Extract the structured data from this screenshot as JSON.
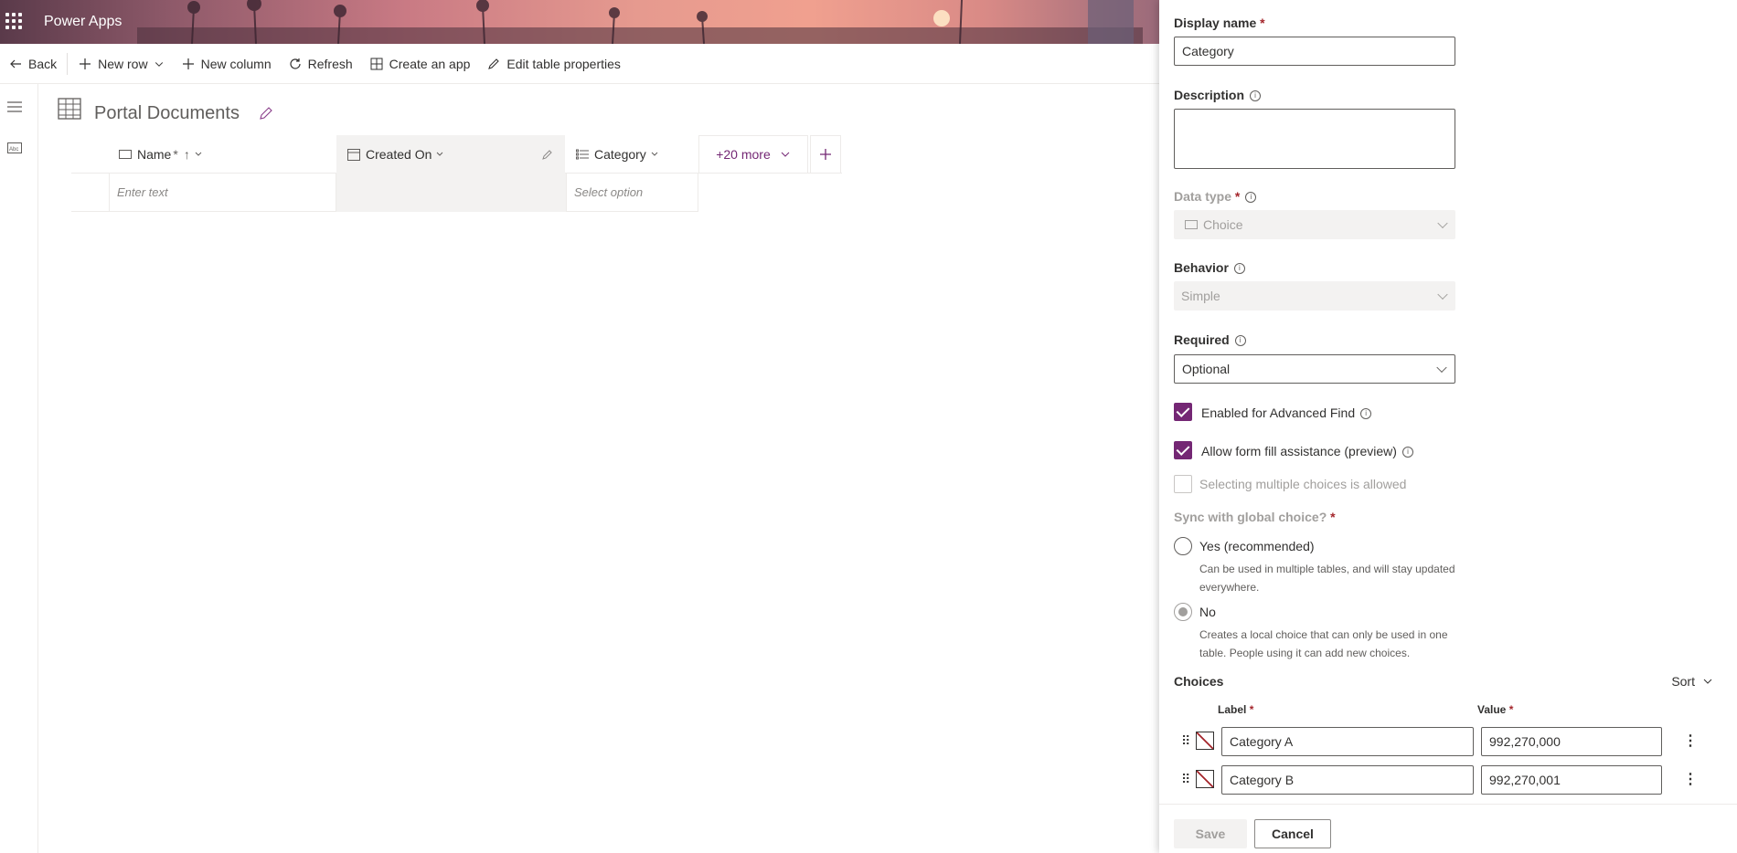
{
  "app": {
    "title": "Power Apps"
  },
  "commandbar": {
    "back": "Back",
    "new_row": "New row",
    "new_column": "New column",
    "refresh": "Refresh",
    "create_app": "Create an app",
    "edit_table_properties": "Edit table properties"
  },
  "table": {
    "title": "Portal Documents",
    "columns": {
      "name": "Name",
      "name_req": "*",
      "name_sort": "↑",
      "created_on": "Created On",
      "category": "Category",
      "more": "+20 more"
    },
    "new_row": {
      "name_placeholder": "Enter text",
      "category_placeholder": "Select option"
    }
  },
  "panel": {
    "display_name_label": "Display name",
    "display_name_value": "Category",
    "description_label": "Description",
    "data_type_label": "Data type",
    "data_type_value": "Choice",
    "behavior_label": "Behavior",
    "behavior_value": "Simple",
    "required_label": "Required",
    "required_value": "Optional",
    "advanced_find": "Enabled for Advanced Find",
    "form_fill": "Allow form fill assistance (preview)",
    "multiple_choices": "Selecting multiple choices is allowed",
    "sync_label": "Sync with global choice?",
    "yes_option": "Yes (recommended)",
    "yes_desc_1": "Can be used in multiple tables, and will stay updated",
    "yes_desc_2": "everywhere.",
    "no_option": "No",
    "no_desc_1": "Creates a local choice that can only be used in one",
    "no_desc_2": "table. People using it can add new choices.",
    "choices_label": "Choices",
    "sort_label": "Sort",
    "label_header": "Label",
    "value_header": "Value",
    "required_marker": "*",
    "choices": [
      {
        "label": "Category A",
        "value": "992,270,000"
      },
      {
        "label": "Category B",
        "value": "992,270,001"
      }
    ],
    "save": "Save",
    "cancel": "Cancel"
  },
  "colors": {
    "accent": "#742774",
    "required": "#a4262c"
  }
}
